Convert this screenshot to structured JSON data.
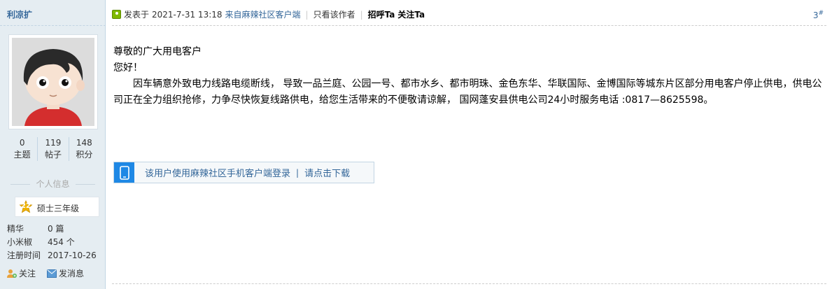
{
  "author": {
    "name": "利凉扩",
    "stats": [
      {
        "value": "0",
        "label": "主题"
      },
      {
        "value": "119",
        "label": "帖子"
      },
      {
        "value": "148",
        "label": "积分"
      }
    ],
    "info_title": "个人信息",
    "level": {
      "badge": "22",
      "name": "硕士三年级"
    },
    "meta": [
      {
        "key": "精华",
        "value": "0 篇"
      },
      {
        "key": "小米椒",
        "value": "454 个"
      },
      {
        "key": "注册时间",
        "value": "2017-10-26"
      }
    ],
    "actions": {
      "follow": "关注",
      "message": "发消息"
    }
  },
  "post": {
    "posted_prefix": "发表于",
    "posted_time": "2021-7-31 13:18",
    "client": "来自麻辣社区客户端",
    "only_author": "只看该作者",
    "greet": "招呼Ta",
    "follow": "关注Ta",
    "floor_num": "3",
    "floor_mark": "#",
    "lines": [
      "尊敬的广大用电客户",
      "您好！",
      "因车辆意外致电力线路电缆断线，  导致一品兰庭、公园一号、都市水乡、都市明珠、金色东华、华联国际、金博国际等城东片区部分用电客户停止供电，供电公司正在全力组织抢修，力争尽快恢复线路供电，给您生活带来的不便敬请谅解，  国网蓬安县供电公司24小时服务电话 :0817—8625598。"
    ],
    "app_banner": {
      "text": "该用户使用麻辣社区手机客户端登录",
      "sep": "|",
      "link": "请点击下载"
    }
  },
  "colors": {
    "sidebar_bg": "#e5edf2",
    "link": "#336699",
    "banner_icon": "#1e88e5",
    "level_badge": "#f0b400"
  }
}
